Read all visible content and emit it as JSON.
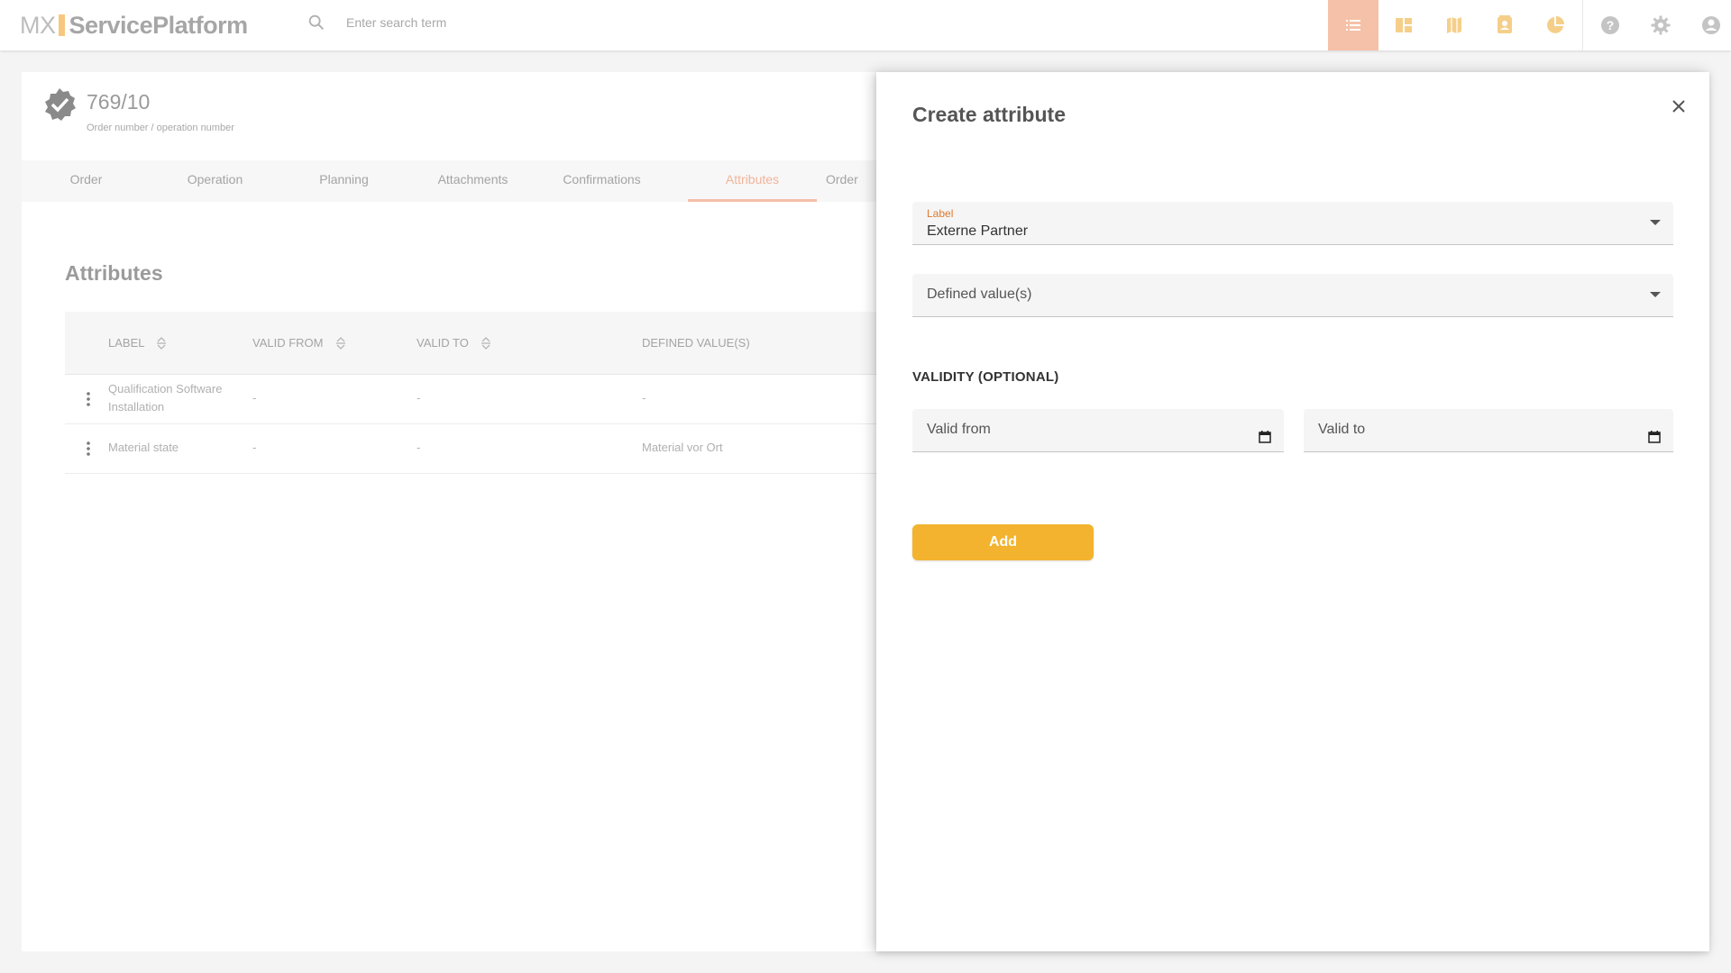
{
  "app": {
    "logo_prefix": "MX",
    "logo_name": "ServicePlatform"
  },
  "search": {
    "placeholder": "Enter search term"
  },
  "nav_icons": [
    "list-icon",
    "dashboard-icon",
    "map-icon",
    "contacts-icon",
    "pie-chart-icon",
    "help-icon",
    "settings-icon",
    "account-icon"
  ],
  "order": {
    "number": "769/10",
    "subtitle": "Order number / operation number"
  },
  "tabs": [
    {
      "label": "Order",
      "active": false
    },
    {
      "label": "Operation",
      "active": false
    },
    {
      "label": "Planning",
      "active": false
    },
    {
      "label": "Attachments",
      "active": false
    },
    {
      "label": "Confirmations",
      "active": false
    },
    {
      "label": "Attributes",
      "active": true
    },
    {
      "label": "Order",
      "active": false
    }
  ],
  "attributes_section": {
    "title": "Attributes",
    "columns": [
      "LABEL",
      "VALID FROM",
      "VALID TO",
      "DEFINED VALUE(S)"
    ],
    "rows": [
      {
        "label_line1": "Qualification Software",
        "label_line2": "Installation",
        "valid_from": "-",
        "valid_to": "-",
        "defined_values": "-"
      },
      {
        "label_line1": "Material state",
        "label_line2": "",
        "valid_from": "-",
        "valid_to": "-",
        "defined_values": "Material vor Ort"
      }
    ]
  },
  "dialog": {
    "title": "Create attribute",
    "label_field": {
      "label": "Label",
      "value": "Externe Partner"
    },
    "defined_values_field": {
      "placeholder": "Defined value(s)"
    },
    "validity_heading": "VALIDITY (OPTIONAL)",
    "valid_from": {
      "placeholder": "Valid from"
    },
    "valid_to": {
      "placeholder": "Valid to"
    },
    "add_button": "Add"
  },
  "colors": {
    "accent_orange": "#e07a2f",
    "add_button": "#f3b32f",
    "active_nav": "#f5c1a8",
    "active_tab": "#f2b49a"
  }
}
